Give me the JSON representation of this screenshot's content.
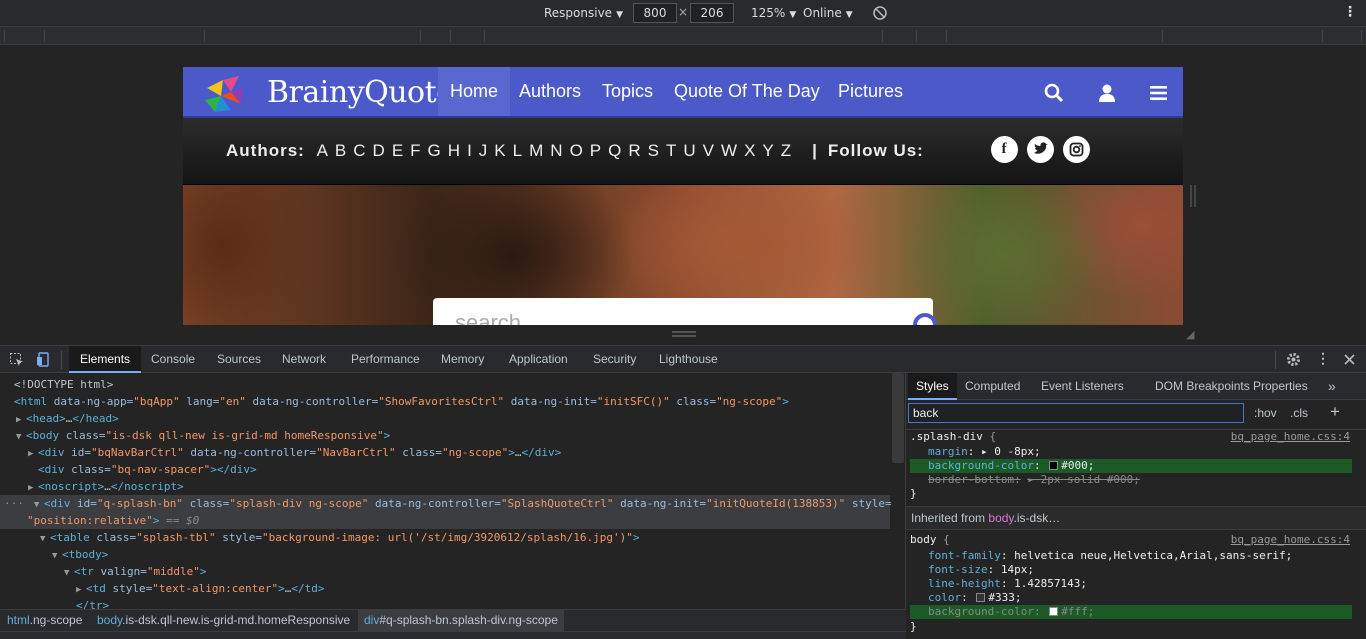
{
  "device_toolbar": {
    "mode": "Responsive",
    "width": "800",
    "height": "206",
    "times": "×",
    "zoom": "125%",
    "throttle": "Online"
  },
  "page": {
    "brand": "BrainyQuote",
    "brand_mark": "®",
    "nav": [
      "Home",
      "Authors",
      "Topics",
      "Quote Of The Day",
      "Pictures"
    ],
    "authors_label": "Authors:",
    "letters": [
      "A",
      "B",
      "C",
      "D",
      "E",
      "F",
      "G",
      "H",
      "I",
      "J",
      "K",
      "L",
      "M",
      "N",
      "O",
      "P",
      "Q",
      "R",
      "S",
      "T",
      "U",
      "V",
      "W",
      "X",
      "Y",
      "Z"
    ],
    "pipe": "|",
    "follow_label": "Follow Us:",
    "search_placeholder": "search"
  },
  "devtools": {
    "tabs": [
      "Elements",
      "Console",
      "Sources",
      "Network",
      "Performance",
      "Memory",
      "Application",
      "Security",
      "Lighthouse"
    ],
    "breadcrumbs": [
      {
        "tag": "html",
        "rest": ".ng-scope"
      },
      {
        "tag": "body",
        "rest": ".is-dsk.qll-new.is-grid-md.homeResponsive"
      },
      {
        "tag": "div",
        "rest": "#q-splash-bn.splash-div.ng-scope"
      }
    ],
    "styles_tabs": [
      "Styles",
      "Computed",
      "Event Listeners",
      "DOM Breakpoints",
      "Properties"
    ],
    "filter_value": "back",
    "hov": ":hov",
    "cls": ".cls",
    "rule1": {
      "selector": ".splash-div",
      "brace_open": "{",
      "source": "bq_page_home.css:4",
      "decls": [
        {
          "name": "margin",
          "colon": ":",
          "value": "▸ 0 -8px;"
        },
        {
          "name": "background-color",
          "colon": ":",
          "value": "#000;"
        },
        {
          "name": "border-bottom",
          "colon": ":",
          "value": "▸ 2px solid #000;"
        }
      ],
      "brace_close": "}"
    },
    "inherited_label": "Inherited from",
    "inherited_tag": "body",
    "inherited_rest": ".is-dsk…",
    "rule2": {
      "selector": "body",
      "brace_open": "{",
      "source": "bq_page_home.css:4",
      "decls": [
        {
          "name": "font-family",
          "colon": ":",
          "value": "helvetica neue,Helvetica,Arial,sans-serif;"
        },
        {
          "name": "font-size",
          "colon": ":",
          "value": "14px;"
        },
        {
          "name": "line-height",
          "colon": ":",
          "value": "1.42857143;"
        },
        {
          "name": "color",
          "colon": ":",
          "value": "#333;"
        },
        {
          "name": "background-color",
          "colon": ":",
          "value": "#fff;"
        }
      ],
      "brace_close": "}"
    },
    "dom": {
      "l0": "<!DOCTYPE html>",
      "l1": {
        "o": "<html",
        "a1": " data-ng-app=",
        "v1": "\"bqApp\"",
        "a2": " lang=",
        "v2": "\"en\"",
        "a3": " data-ng-controller=",
        "v3": "\"ShowFavoritesCtrl\"",
        "a4": " data-ng-init=",
        "v4": "\"initSFC()\"",
        "a5": " class=",
        "v5": "\"ng-scope\"",
        "c": ">"
      },
      "l2": {
        "o": "<head>",
        "m": "…",
        "c": "</head>"
      },
      "l3": {
        "o": "<body",
        "a1": " class=",
        "v1": "\"is-dsk qll-new is-grid-md homeResponsive\"",
        "c": ">"
      },
      "l4": {
        "o": "<div",
        "a1": " id=",
        "v1": "\"bqNavBarCtrl\"",
        "a2": " data-ng-controller=",
        "v2": "\"NavBarCtrl\"",
        "a3": " class=",
        "v3": "\"ng-scope\"",
        "c": ">",
        "m": "…",
        "e": "</div>"
      },
      "l5": {
        "o": "<div",
        "a1": " class=",
        "v1": "\"bq-nav-spacer\"",
        "c": "></div>"
      },
      "l6": {
        "o": "<noscript>",
        "m": "…",
        "c": "</noscript>"
      },
      "l7": {
        "o": "<div",
        "a1": " id=",
        "v1": "\"q-splash-bn\"",
        "a2": " class=",
        "v2": "\"splash-div ng-scope\"",
        "a3": " data-ng-controller=",
        "v3": "\"SplashQuoteCtrl\"",
        "a4": " data-ng-init=",
        "v4": "\"initQuoteId(138853)\"",
        "a5": " style=",
        "dots": "…"
      },
      "l8": {
        "v": "\"position:relative\"",
        "c": ">",
        "eq": " == $0"
      },
      "l9": {
        "o": "<table",
        "a1": " class=",
        "v1": "\"splash-tbl\"",
        "a2": " style=",
        "v2": "\"background-image: url('/st/img/3920612/splash/16.jpg')\"",
        "c": ">"
      },
      "l10": {
        "o": "<tbody>"
      },
      "l11": {
        "o": "<tr",
        "a1": " valign=",
        "v1": "\"middle\"",
        "c": ">"
      },
      "l12": {
        "o": "<td",
        "a1": " style=",
        "v1": "\"text-align:center\"",
        "c": ">",
        "m": "…",
        "e": "</td>"
      },
      "l13": {
        "o": "</tr>"
      }
    }
  },
  "colors": {
    "nav_bg": "#4b59c9",
    "devtools_bg": "#242424",
    "accent": "#7cacf8"
  },
  "icons": [
    "inspect-icon",
    "device-toggle-icon",
    "rotate-icon",
    "kebab-menu-icon",
    "search-icon",
    "user-icon",
    "hamburger-icon",
    "facebook-icon",
    "twitter-icon",
    "instagram-icon",
    "gear-icon",
    "close-icon",
    "more-tabs-icon",
    "add-rule-icon"
  ]
}
